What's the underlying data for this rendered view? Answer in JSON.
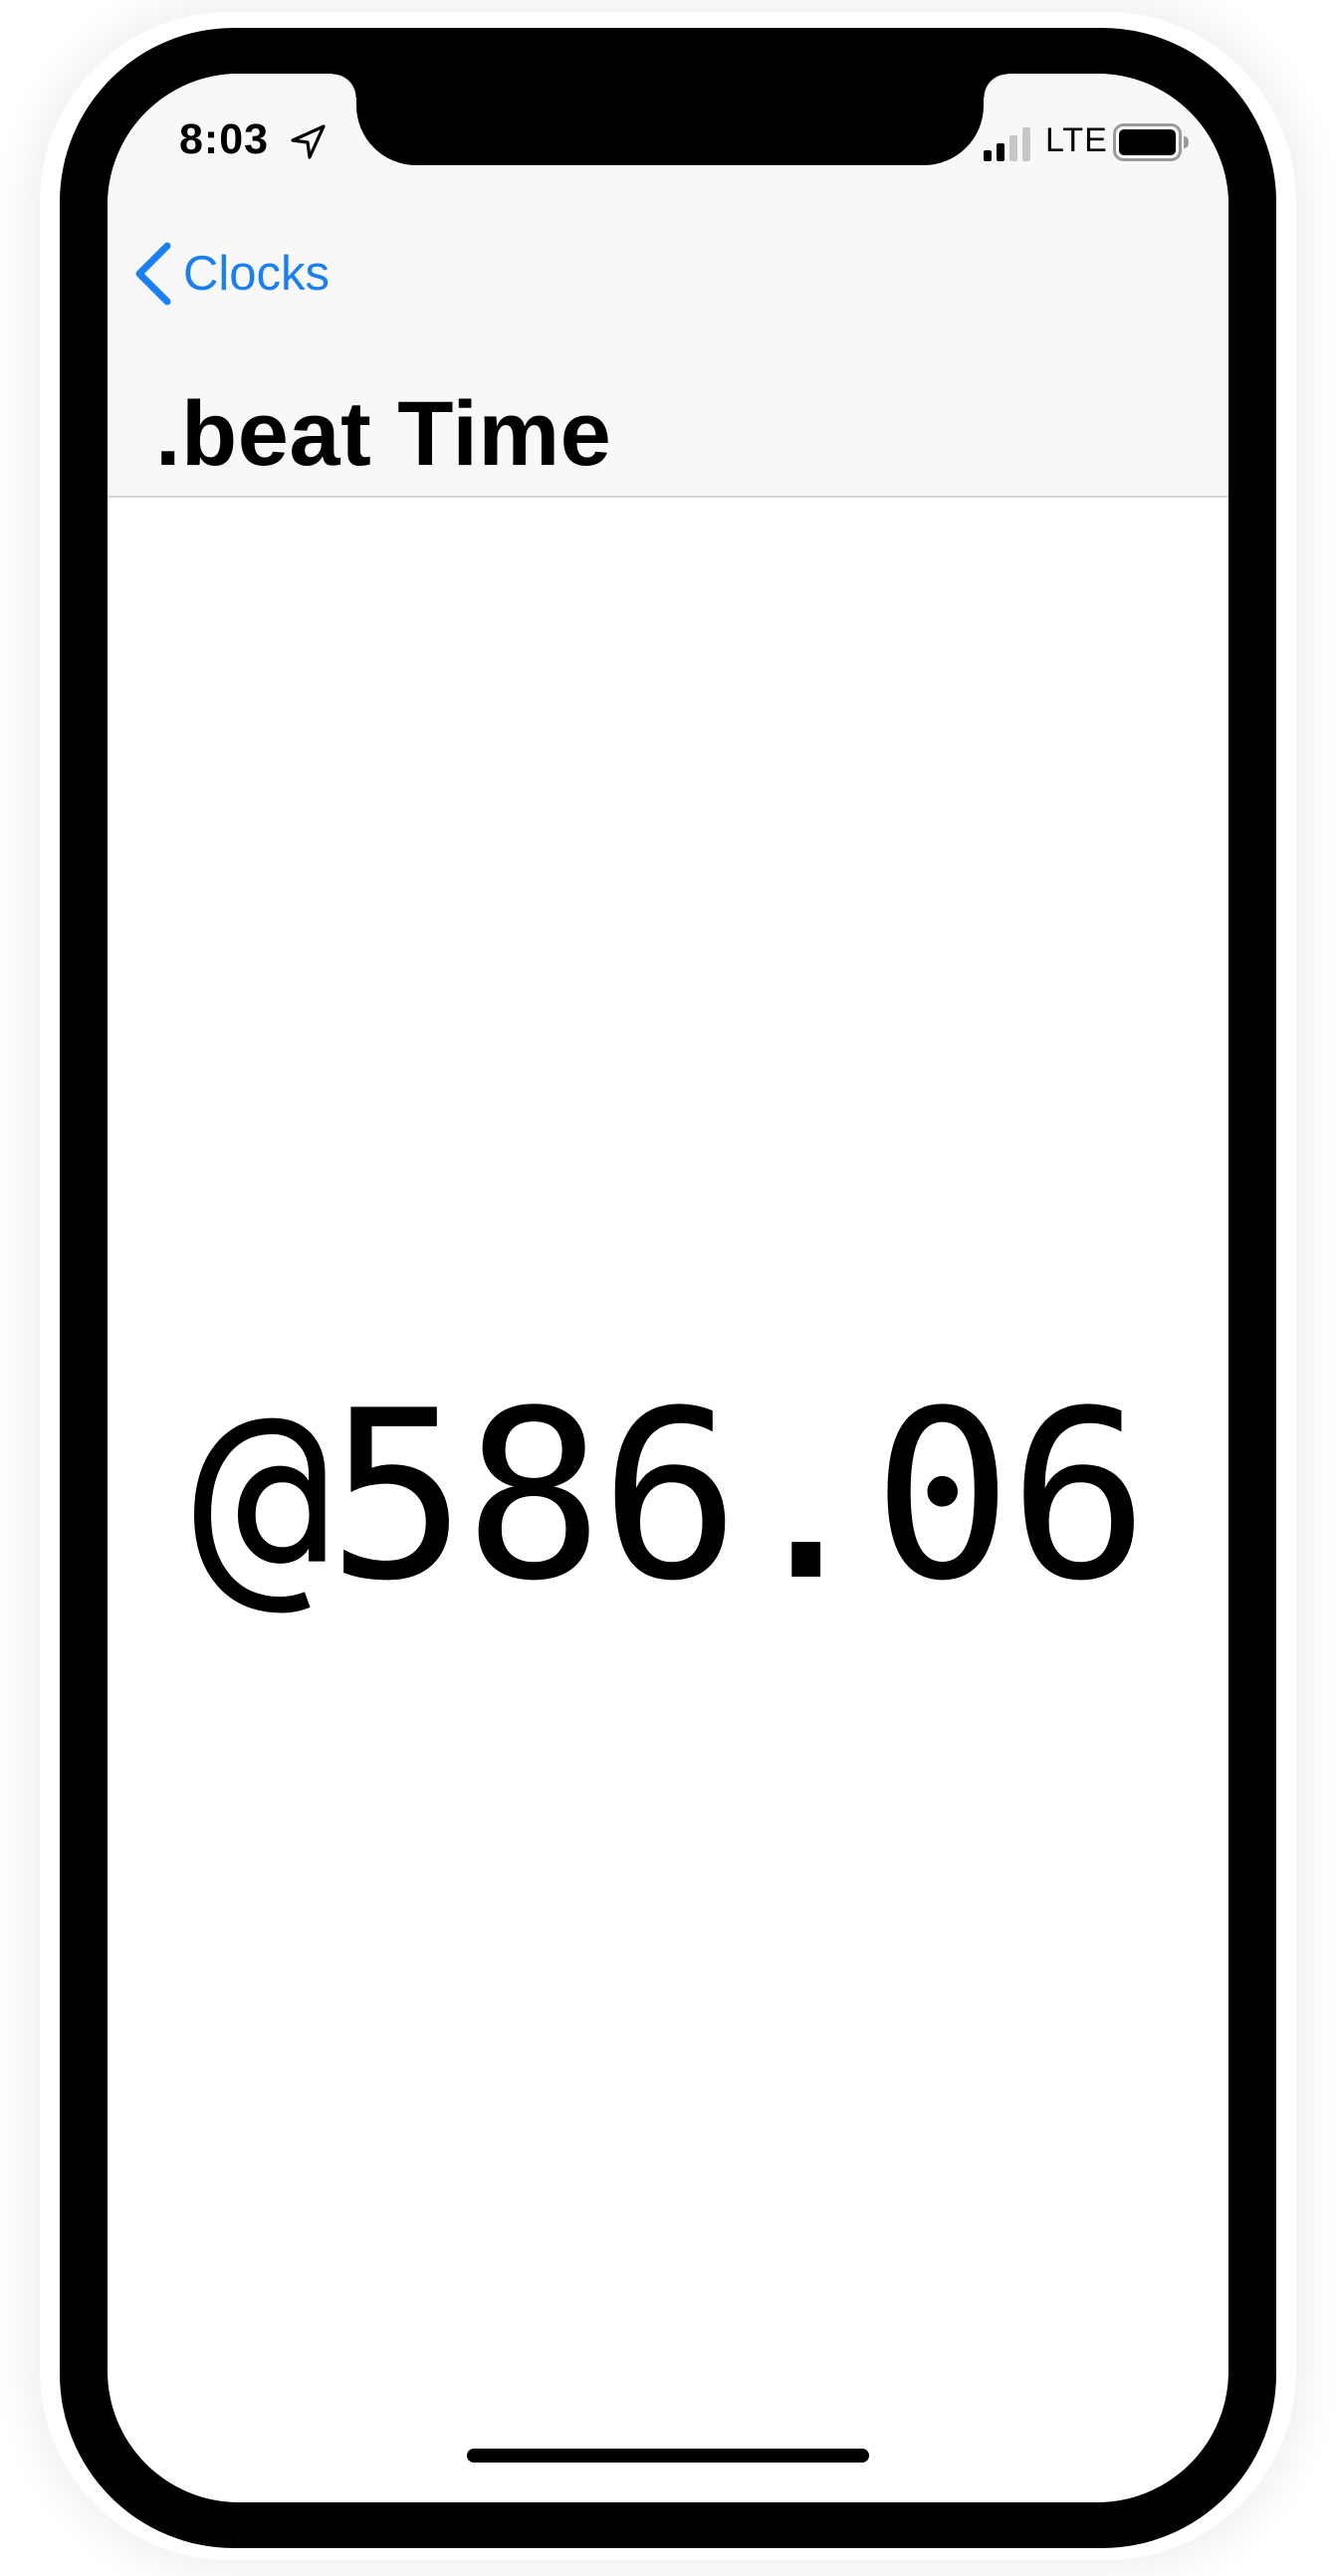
{
  "status_bar": {
    "time": "8:03",
    "location_icon": "location-arrow-icon",
    "signal_icon": "cellular-signal-icon",
    "signal_bars": 2,
    "network": "LTE",
    "battery_icon": "battery-icon",
    "battery_level": 0.95
  },
  "nav": {
    "back_label": "Clocks",
    "back_icon": "chevron-left-icon",
    "title": ".beat Time",
    "accent_color": "#1a7ff2"
  },
  "main": {
    "beat_time": "@586.06"
  }
}
